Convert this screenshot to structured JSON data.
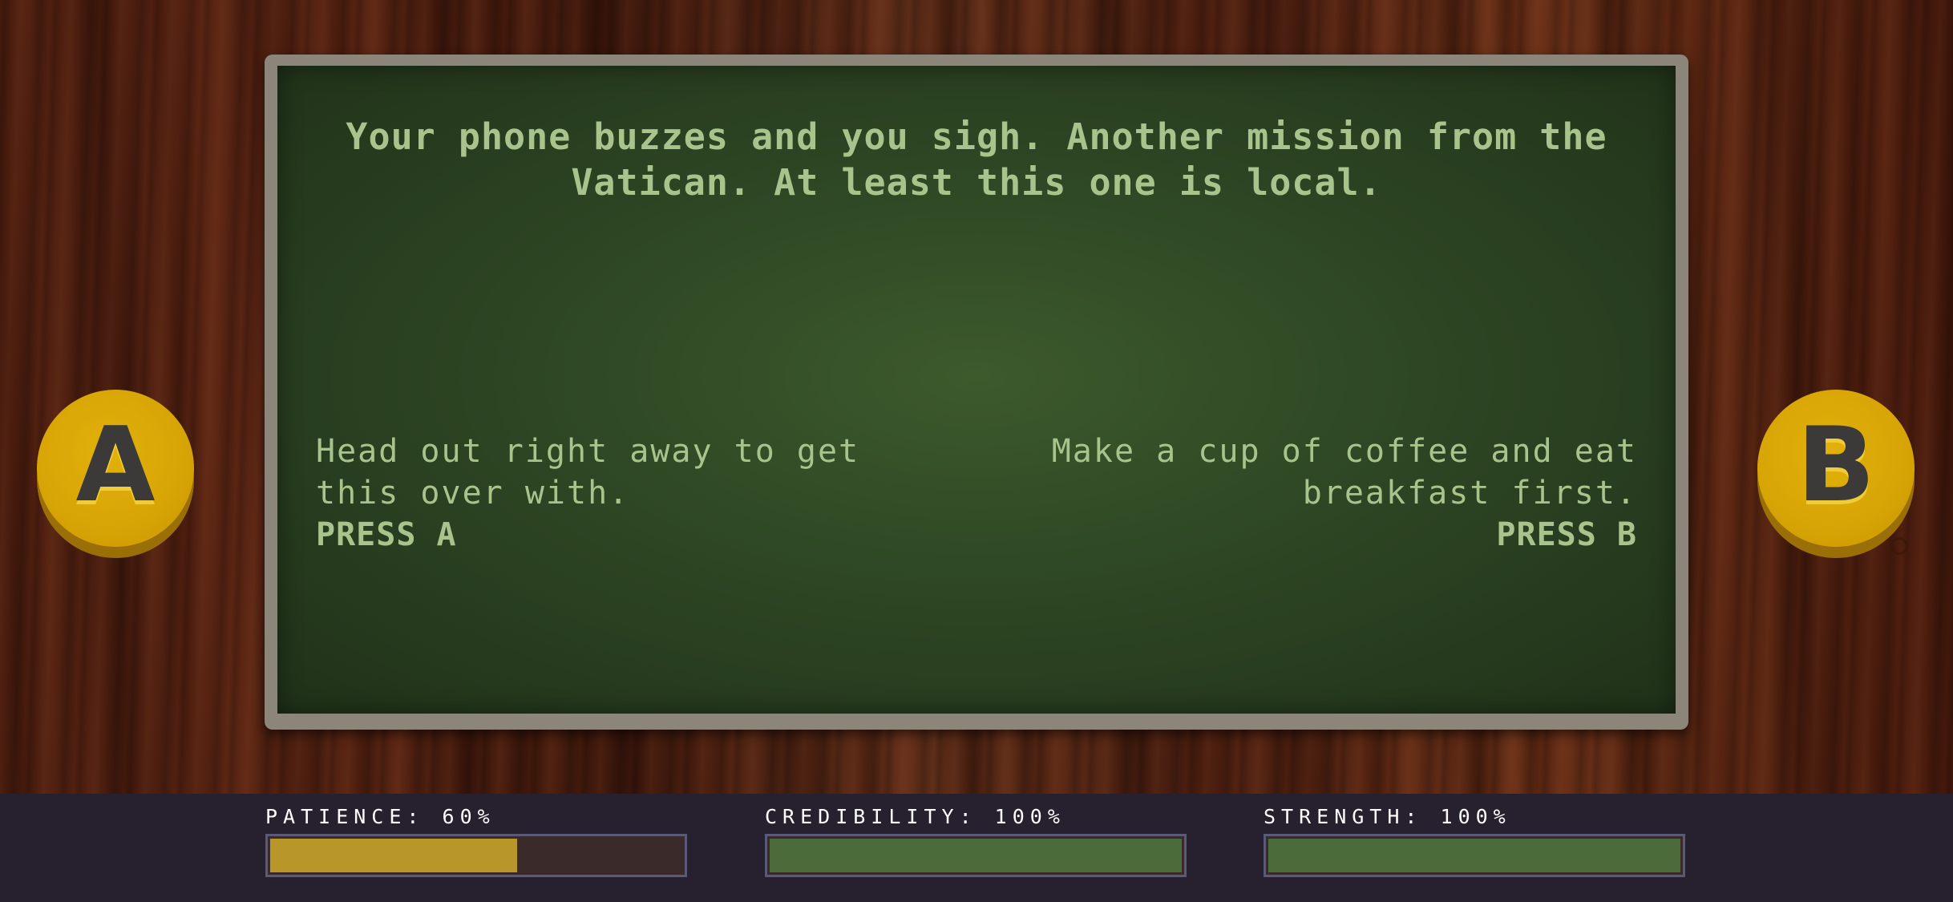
{
  "dialog": {
    "message": "Your phone buzzes and you sigh. Another mission from the Vatican. At least this one is local."
  },
  "choices": {
    "a": {
      "text": "Head out right away to get this over with.",
      "prompt": "PRESS A"
    },
    "b": {
      "text": "Make a cup of coffee and eat breakfast first.",
      "prompt": "PRESS B"
    }
  },
  "buttons": {
    "a_label": "A",
    "b_label": "B"
  },
  "stats": [
    {
      "label": "PATIENCE: 60%",
      "value": 0.6,
      "color": "#b8962a"
    },
    {
      "label": "CREDIBILITY: 100%",
      "value": 1.0,
      "color": "#4b6b3a"
    },
    {
      "label": "STRENGTH: 100%",
      "value": 1.0,
      "color": "#4b6b3a"
    }
  ],
  "colors": {
    "screen_text": "#a9c38c",
    "button_yellow": "#d7a406",
    "hud_background": "#27212f"
  }
}
